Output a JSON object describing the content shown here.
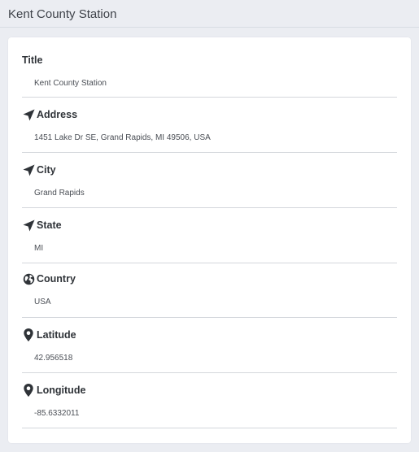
{
  "header": {
    "title": "Kent County Station"
  },
  "fields": [
    {
      "label": "Title",
      "value": "Kent County Station",
      "icon": ""
    },
    {
      "label": "Address",
      "value": "1451 Lake Dr SE, Grand Rapids, MI 49506, USA",
      "icon": "paper-plane-icon"
    },
    {
      "label": "City",
      "value": "Grand Rapids",
      "icon": "paper-plane-icon"
    },
    {
      "label": "State",
      "value": "MI",
      "icon": "paper-plane-icon"
    },
    {
      "label": "Country",
      "value": "USA",
      "icon": "globe-icon"
    },
    {
      "label": "Latitude",
      "value": "42.956518",
      "icon": "map-pin-icon"
    },
    {
      "label": "Longitude",
      "value": "-85.6332011",
      "icon": "map-pin-icon"
    }
  ],
  "colors": {
    "background": "#ebedf2",
    "card": "#ffffff",
    "text": "#2f3338",
    "divider": "#d4d7dc"
  }
}
